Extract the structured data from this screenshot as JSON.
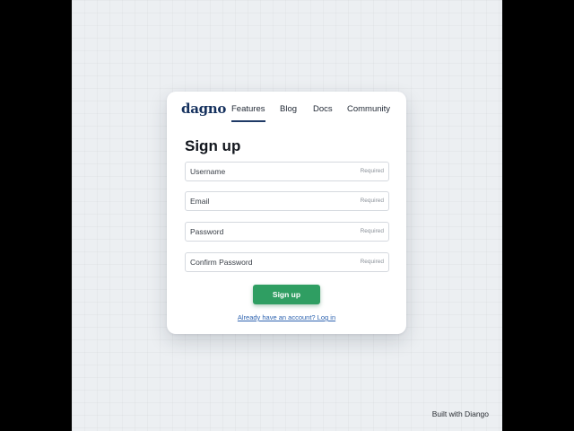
{
  "nav": {
    "logo": "dagno",
    "links": [
      {
        "label": "Features",
        "active": true
      },
      {
        "label": "Blog"
      },
      {
        "label": "Docs"
      },
      {
        "label": "Community"
      }
    ]
  },
  "form": {
    "title": "Sign up",
    "fields": [
      {
        "label": "Username",
        "hint": "Required",
        "value": ""
      },
      {
        "label": "Email",
        "hint": "Required",
        "value": ""
      },
      {
        "label": "Password",
        "hint": "Required",
        "value": ""
      },
      {
        "label": "Confirm Password",
        "hint": "Required",
        "value": ""
      }
    ],
    "submit_label": "Sign up",
    "login_link": "Already have an account? Log in"
  },
  "footer": {
    "built_with": "Built with Diango"
  },
  "colors": {
    "brand": "#15315e",
    "accent": "#2f9e62",
    "link": "#2f64b0",
    "background": "#eceff2"
  }
}
